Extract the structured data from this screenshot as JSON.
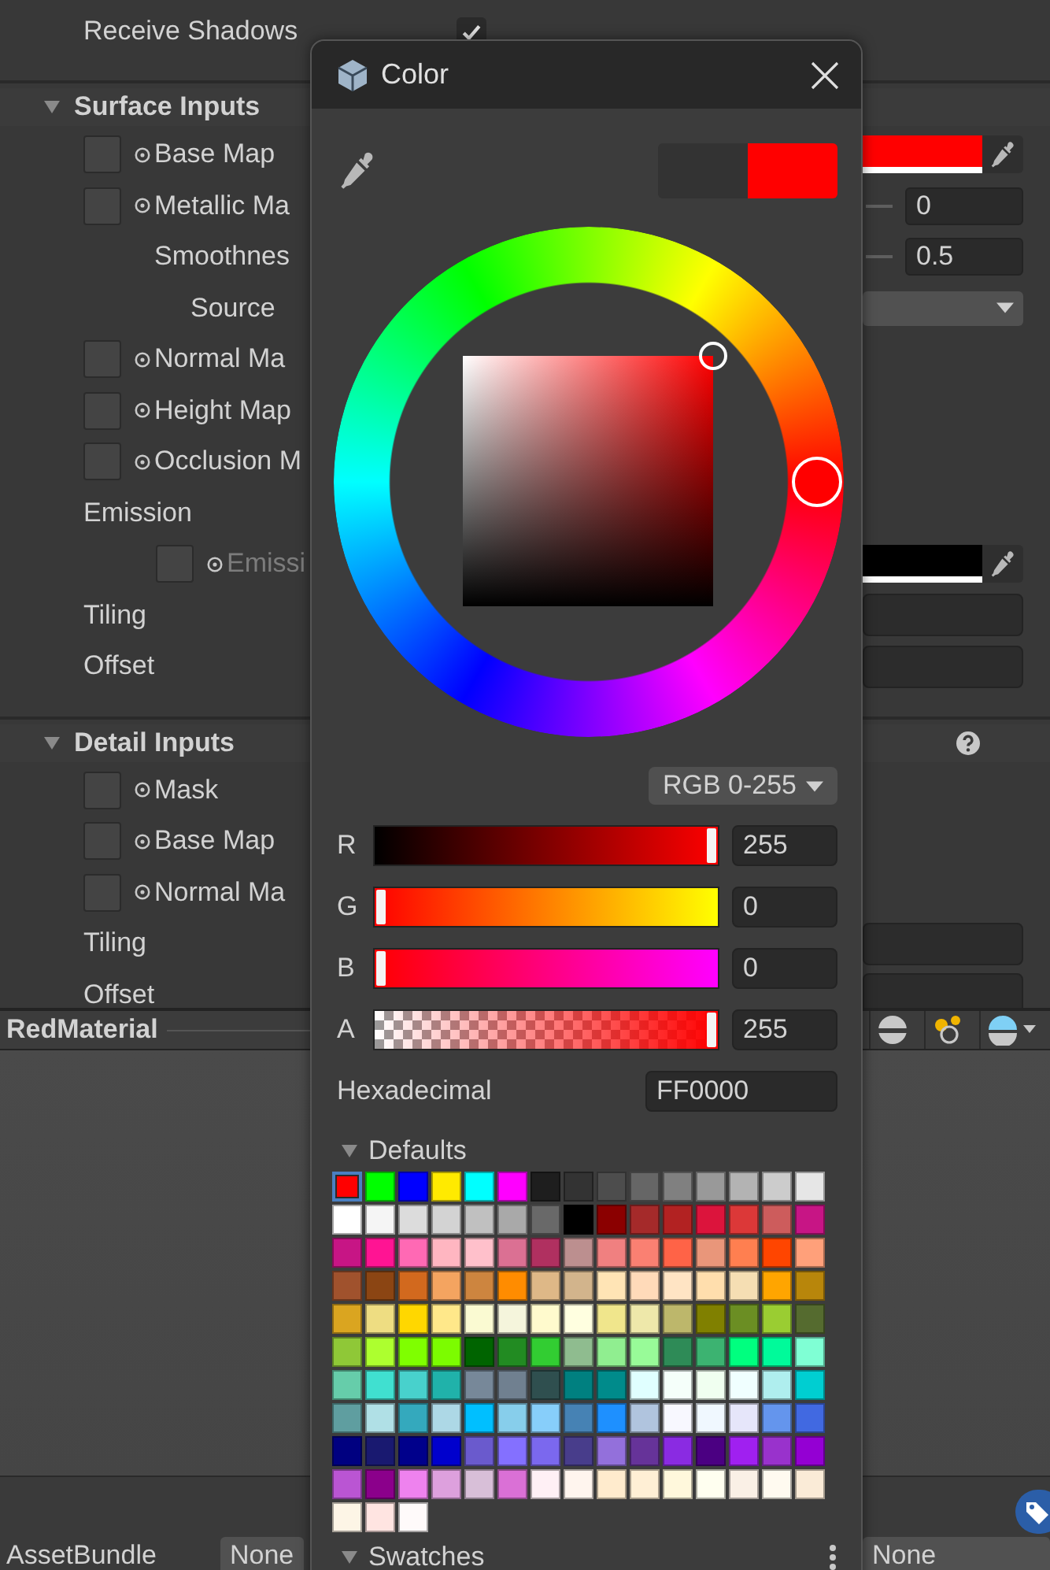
{
  "inspector": {
    "receive_shadows": {
      "label": "Receive Shadows",
      "checked": true
    },
    "sections": [
      {
        "title": "Surface Inputs",
        "expanded": true,
        "rows": [
          {
            "kind": "texture",
            "label": "Base Map",
            "disabled": false,
            "control": {
              "kind": "color",
              "color": "#ff0000"
            }
          },
          {
            "kind": "texture",
            "label": "Metallic Ma",
            "disabled": false,
            "control": {
              "kind": "slider",
              "value": "0"
            }
          },
          {
            "kind": "property",
            "label": "Smoothnes",
            "control": {
              "kind": "slider",
              "value": "0.5"
            },
            "children": [
              {
                "kind": "property",
                "label": "Source",
                "control": {
                  "kind": "dropdown"
                }
              }
            ]
          },
          {
            "kind": "texture",
            "label": "Normal Ma",
            "disabled": false
          },
          {
            "kind": "texture",
            "label": "Height Map",
            "disabled": false
          },
          {
            "kind": "texture",
            "label": "Occlusion M",
            "disabled": false
          },
          {
            "kind": "label",
            "label": "Emission",
            "children": [
              {
                "kind": "texture",
                "label": "Emissi",
                "disabled": true,
                "control": {
                  "kind": "color",
                  "color": "#000000"
                }
              }
            ]
          },
          {
            "kind": "label",
            "label": "Tiling",
            "control": {
              "kind": "vector"
            }
          },
          {
            "kind": "label",
            "label": "Offset",
            "control": {
              "kind": "vector"
            }
          }
        ]
      },
      {
        "title": "Detail Inputs",
        "expanded": true,
        "help": true,
        "rows": [
          {
            "kind": "texture",
            "label": "Mask",
            "disabled": false
          },
          {
            "kind": "texture",
            "label": "Base Map",
            "disabled": false
          },
          {
            "kind": "texture",
            "label": "Normal Ma",
            "disabled": false
          },
          {
            "kind": "label",
            "label": "Tiling",
            "control": {
              "kind": "vector"
            }
          },
          {
            "kind": "label",
            "label": "Offset",
            "control": {
              "kind": "vector"
            }
          }
        ]
      }
    ]
  },
  "preview_bar": {
    "title": "RedMaterial"
  },
  "asset_bar": {
    "label": "AssetBundle",
    "bundle": "None",
    "variant": "None"
  },
  "color_picker": {
    "title": "Color",
    "mode": "RGB 0-255",
    "channels": [
      {
        "label": "R",
        "level": 1,
        "value": "255"
      },
      {
        "label": "G",
        "level": 0,
        "value": "0"
      },
      {
        "label": "B",
        "level": 0,
        "value": "0"
      },
      {
        "label": "A",
        "level": 1,
        "value": "255"
      }
    ],
    "hex_label": "Hexadecimal",
    "hex": "FF0000",
    "defaults": {
      "label": "Defaults",
      "expanded": true,
      "swatches": [
        {
          "color": "#ff0000",
          "selected": true
        },
        {
          "color": "#00ff00",
          "selected": false
        },
        {
          "color": "#0000ff",
          "selected": false
        },
        {
          "color": "#ffea00",
          "selected": false
        },
        {
          "color": "#00ffff",
          "selected": false
        },
        {
          "color": "#ff00ff",
          "selected": false
        },
        {
          "color": "#1e1e1e",
          "selected": false
        },
        {
          "color": "#333333",
          "selected": false
        },
        {
          "color": "#4d4d4d",
          "selected": false
        },
        {
          "color": "#666666",
          "selected": false
        },
        {
          "color": "#808080",
          "selected": false
        },
        {
          "color": "#999999",
          "selected": false
        },
        {
          "color": "#b3b3b3",
          "selected": false
        },
        {
          "color": "#cccccc",
          "selected": false
        },
        {
          "color": "#e6e6e6",
          "selected": false
        },
        {
          "color": "#ffffff",
          "selected": false
        },
        {
          "color": "#f5f5f5",
          "selected": false
        },
        {
          "color": "#dcdcdc",
          "selected": false
        },
        {
          "color": "#d3d3d3",
          "selected": false
        },
        {
          "color": "#c0c0c0",
          "selected": false
        },
        {
          "color": "#a9a9a9",
          "selected": false
        },
        {
          "color": "#696969",
          "selected": false
        },
        {
          "color": "#000000",
          "selected": false
        },
        {
          "color": "#8b0000",
          "selected": false
        },
        {
          "color": "#a52a2a",
          "selected": false
        },
        {
          "color": "#b22222",
          "selected": false
        },
        {
          "color": "#dc143c",
          "selected": false
        },
        {
          "color": "#dc3838",
          "selected": false
        },
        {
          "color": "#cd5c5c",
          "selected": false
        },
        {
          "color": "#c71585",
          "selected": false
        },
        {
          "color": "#c71585",
          "selected": false
        },
        {
          "color": "#ff1493",
          "selected": false
        },
        {
          "color": "#ff69b4",
          "selected": false
        },
        {
          "color": "#ffb6c1",
          "selected": false
        },
        {
          "color": "#ffc0cb",
          "selected": false
        },
        {
          "color": "#db7093",
          "selected": false
        },
        {
          "color": "#b03060",
          "selected": false
        },
        {
          "color": "#bc8f8f",
          "selected": false
        },
        {
          "color": "#f08080",
          "selected": false
        },
        {
          "color": "#fa8072",
          "selected": false
        },
        {
          "color": "#ff6347",
          "selected": false
        },
        {
          "color": "#e9967a",
          "selected": false
        },
        {
          "color": "#ff7f50",
          "selected": false
        },
        {
          "color": "#ff4500",
          "selected": false
        },
        {
          "color": "#ffa07a",
          "selected": false
        },
        {
          "color": "#a0522d",
          "selected": false
        },
        {
          "color": "#8b4513",
          "selected": false
        },
        {
          "color": "#d2691e",
          "selected": false
        },
        {
          "color": "#f4a460",
          "selected": false
        },
        {
          "color": "#cd853f",
          "selected": false
        },
        {
          "color": "#ff8c00",
          "selected": false
        },
        {
          "color": "#deb887",
          "selected": false
        },
        {
          "color": "#d2b48c",
          "selected": false
        },
        {
          "color": "#ffe4b5",
          "selected": false
        },
        {
          "color": "#ffdab9",
          "selected": false
        },
        {
          "color": "#ffe4c4",
          "selected": false
        },
        {
          "color": "#ffdead",
          "selected": false
        },
        {
          "color": "#f5deb3",
          "selected": false
        },
        {
          "color": "#ffa500",
          "selected": false
        },
        {
          "color": "#b8860b",
          "selected": false
        },
        {
          "color": "#daa520",
          "selected": false
        },
        {
          "color": "#eedd82",
          "selected": false
        },
        {
          "color": "#ffd700",
          "selected": false
        },
        {
          "color": "#ffe88a",
          "selected": false
        },
        {
          "color": "#fafad2",
          "selected": false
        },
        {
          "color": "#f5f5dc",
          "selected": false
        },
        {
          "color": "#fffacd",
          "selected": false
        },
        {
          "color": "#ffffe0",
          "selected": false
        },
        {
          "color": "#f0e68c",
          "selected": false
        },
        {
          "color": "#eee8aa",
          "selected": false
        },
        {
          "color": "#bdb76b",
          "selected": false
        },
        {
          "color": "#808000",
          "selected": false
        },
        {
          "color": "#6b8e23",
          "selected": false
        },
        {
          "color": "#9acd32",
          "selected": false
        },
        {
          "color": "#556b2f",
          "selected": false
        },
        {
          "color": "#8fc837",
          "selected": false
        },
        {
          "color": "#adff2f",
          "selected": false
        },
        {
          "color": "#7fff00",
          "selected": false
        },
        {
          "color": "#7cfc00",
          "selected": false
        },
        {
          "color": "#006400",
          "selected": false
        },
        {
          "color": "#228b22",
          "selected": false
        },
        {
          "color": "#32cd32",
          "selected": false
        },
        {
          "color": "#8fbc8f",
          "selected": false
        },
        {
          "color": "#90ee90",
          "selected": false
        },
        {
          "color": "#98fb98",
          "selected": false
        },
        {
          "color": "#2e8b57",
          "selected": false
        },
        {
          "color": "#3cb371",
          "selected": false
        },
        {
          "color": "#00ff7f",
          "selected": false
        },
        {
          "color": "#00fa9a",
          "selected": false
        },
        {
          "color": "#7fffd4",
          "selected": false
        },
        {
          "color": "#66cdaa",
          "selected": false
        },
        {
          "color": "#40e0d0",
          "selected": false
        },
        {
          "color": "#48d1cc",
          "selected": false
        },
        {
          "color": "#20b2aa",
          "selected": false
        },
        {
          "color": "#778899",
          "selected": false
        },
        {
          "color": "#708090",
          "selected": false
        },
        {
          "color": "#2f4f4f",
          "selected": false
        },
        {
          "color": "#008080",
          "selected": false
        },
        {
          "color": "#008b8b",
          "selected": false
        },
        {
          "color": "#e0ffff",
          "selected": false
        },
        {
          "color": "#f5fffa",
          "selected": false
        },
        {
          "color": "#f0fff0",
          "selected": false
        },
        {
          "color": "#f0ffff",
          "selected": false
        },
        {
          "color": "#afeeee",
          "selected": false
        },
        {
          "color": "#00ced1",
          "selected": false
        },
        {
          "color": "#5f9ea0",
          "selected": false
        },
        {
          "color": "#b0e0e6",
          "selected": false
        },
        {
          "color": "#34a9bd",
          "selected": false
        },
        {
          "color": "#add8e6",
          "selected": false
        },
        {
          "color": "#00bfff",
          "selected": false
        },
        {
          "color": "#87ceeb",
          "selected": false
        },
        {
          "color": "#87cefa",
          "selected": false
        },
        {
          "color": "#4682b4",
          "selected": false
        },
        {
          "color": "#1e90ff",
          "selected": false
        },
        {
          "color": "#b0c4de",
          "selected": false
        },
        {
          "color": "#f8f8ff",
          "selected": false
        },
        {
          "color": "#f0f8ff",
          "selected": false
        },
        {
          "color": "#e6e6fa",
          "selected": false
        },
        {
          "color": "#6495ed",
          "selected": false
        },
        {
          "color": "#4169e1",
          "selected": false
        },
        {
          "color": "#000080",
          "selected": false
        },
        {
          "color": "#191970",
          "selected": false
        },
        {
          "color": "#00008b",
          "selected": false
        },
        {
          "color": "#0000cd",
          "selected": false
        },
        {
          "color": "#6a5acd",
          "selected": false
        },
        {
          "color": "#8470ff",
          "selected": false
        },
        {
          "color": "#7b68ee",
          "selected": false
        },
        {
          "color": "#483d8b",
          "selected": false
        },
        {
          "color": "#9370db",
          "selected": false
        },
        {
          "color": "#663399",
          "selected": false
        },
        {
          "color": "#8a2be2",
          "selected": false
        },
        {
          "color": "#4b0082",
          "selected": false
        },
        {
          "color": "#a020f0",
          "selected": false
        },
        {
          "color": "#9932cc",
          "selected": false
        },
        {
          "color": "#9400d3",
          "selected": false
        },
        {
          "color": "#ba55d3",
          "selected": false
        },
        {
          "color": "#8b008b",
          "selected": false
        },
        {
          "color": "#ee82ee",
          "selected": false
        },
        {
          "color": "#dda0dd",
          "selected": false
        },
        {
          "color": "#d8bfd8",
          "selected": false
        },
        {
          "color": "#da70d6",
          "selected": false
        },
        {
          "color": "#fff0f5",
          "selected": false
        },
        {
          "color": "#fff5ee",
          "selected": false
        },
        {
          "color": "#ffebcd",
          "selected": false
        },
        {
          "color": "#ffefd5",
          "selected": false
        },
        {
          "color": "#fff8dc",
          "selected": false
        },
        {
          "color": "#fffff0",
          "selected": false
        },
        {
          "color": "#faf0e6",
          "selected": false
        },
        {
          "color": "#fffaf0",
          "selected": false
        },
        {
          "color": "#faebd7",
          "selected": false
        },
        {
          "color": "#fdf5e6",
          "selected": false
        },
        {
          "color": "#ffe4e1",
          "selected": false
        },
        {
          "color": "#fffafa",
          "selected": false
        }
      ]
    },
    "swatches": {
      "label": "Swatches",
      "expanded": true
    }
  }
}
